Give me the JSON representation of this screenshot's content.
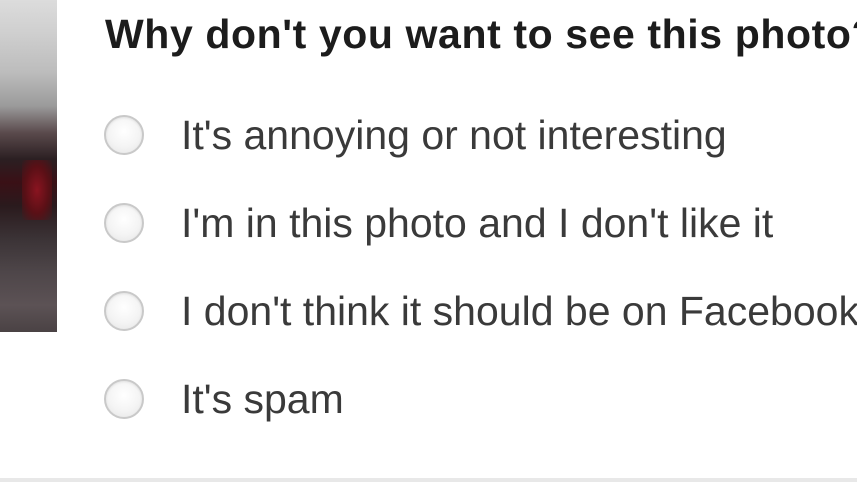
{
  "dialog": {
    "question": "Why don't you want to see this photo?",
    "options": [
      {
        "label": "It's annoying or not interesting",
        "selected": false
      },
      {
        "label": "I'm in this photo and I don't like it",
        "selected": false
      },
      {
        "label": "I don't think it should be on Facebook",
        "selected": false
      },
      {
        "label": "It's spam",
        "selected": false
      }
    ]
  }
}
